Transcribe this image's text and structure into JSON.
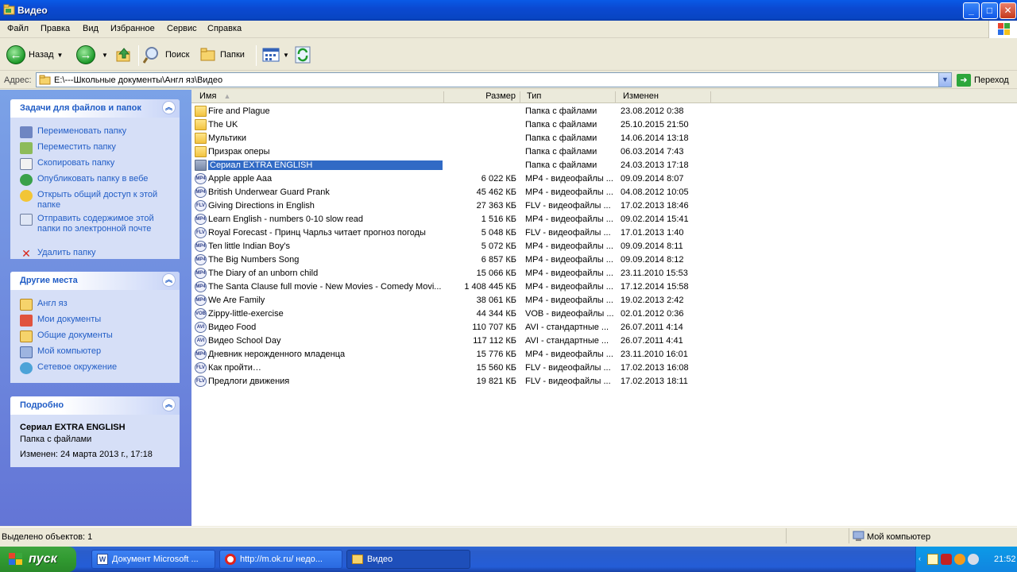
{
  "window": {
    "title": "Видео",
    "min": "_",
    "max": "□",
    "close": "✕"
  },
  "menu": [
    "Файл",
    "Правка",
    "Вид",
    "Избранное",
    "Сервис",
    "Справка"
  ],
  "toolbar": {
    "back": "Назад",
    "search": "Поиск",
    "folders": "Папки"
  },
  "address": {
    "label": "Адрес:",
    "path": "E:\\---Школьные документы\\Англ яз\\Видео",
    "go": "Переход"
  },
  "tasks_panel": {
    "title": "Задачи для файлов и папок",
    "items": [
      {
        "label": "Переименовать папку",
        "icon": "rename-icon"
      },
      {
        "label": "Переместить папку",
        "icon": "move-icon"
      },
      {
        "label": "Скопировать папку",
        "icon": "copy-icon"
      },
      {
        "label": "Опубликовать папку в вебе",
        "icon": "publish-web-icon"
      },
      {
        "label": "Открыть общий доступ к этой папке",
        "icon": "share-icon"
      },
      {
        "label": "Отправить содержимое этой папки по электронной почте",
        "icon": "email-icon"
      },
      {
        "label": "Удалить папку",
        "icon": "delete-icon"
      }
    ]
  },
  "places_panel": {
    "title": "Другие места",
    "items": [
      {
        "label": "Англ яз",
        "icon": "folder-icon"
      },
      {
        "label": "Мои документы",
        "icon": "my-documents-icon"
      },
      {
        "label": "Общие документы",
        "icon": "shared-documents-icon"
      },
      {
        "label": "Мой компьютер",
        "icon": "my-computer-icon"
      },
      {
        "label": "Сетевое окружение",
        "icon": "network-icon"
      }
    ]
  },
  "details_panel": {
    "title": "Подробно",
    "name": "Сериал EXTRA ENGLISH",
    "type": "Папка с файлами",
    "modified": "Изменен: 24 марта 2013 г., 17:18"
  },
  "columns": {
    "name": "Имя",
    "size": "Размер",
    "type": "Тип",
    "modified": "Изменен"
  },
  "files": [
    {
      "name": "Fire and Plague",
      "size": "",
      "type": "Папка с файлами",
      "modified": "23.08.2012 0:38",
      "kind": "folder"
    },
    {
      "name": "The UK",
      "size": "",
      "type": "Папка с файлами",
      "modified": "25.10.2015 21:50",
      "kind": "folder"
    },
    {
      "name": "Мультики",
      "size": "",
      "type": "Папка с файлами",
      "modified": "14.06.2014 13:18",
      "kind": "folder"
    },
    {
      "name": "Призрак оперы",
      "size": "",
      "type": "Папка с файлами",
      "modified": "06.03.2014 7:43",
      "kind": "folder"
    },
    {
      "name": "Сериал EXTRA ENGLISH",
      "size": "",
      "type": "Папка с файлами",
      "modified": "24.03.2013 17:18",
      "kind": "folder-selected"
    },
    {
      "name": "Apple apple Aaa",
      "size": "6 022 КБ",
      "type": "MP4 - видеофайлы ...",
      "modified": "09.09.2014 8:07",
      "kind": "mp4"
    },
    {
      "name": "British Underwear Guard Prank",
      "size": "45 462 КБ",
      "type": "MP4 - видеофайлы ...",
      "modified": "04.08.2012 10:05",
      "kind": "mp4"
    },
    {
      "name": "Giving Directions in English",
      "size": "27 363 КБ",
      "type": "FLV - видеофайлы ...",
      "modified": "17.02.2013 18:46",
      "kind": "flv"
    },
    {
      "name": "Learn English - numbers 0-10 slow read",
      "size": "1 516 КБ",
      "type": "MP4 - видеофайлы ...",
      "modified": "09.02.2014 15:41",
      "kind": "mp4"
    },
    {
      "name": "Royal Forecast - Принц Чарльз читает прогноз погоды",
      "size": "5 048 КБ",
      "type": "FLV - видеофайлы ...",
      "modified": "17.01.2013 1:40",
      "kind": "flv"
    },
    {
      "name": "Ten little Indian Boy's",
      "size": "5 072 КБ",
      "type": "MP4 - видеофайлы ...",
      "modified": "09.09.2014 8:11",
      "kind": "mp4"
    },
    {
      "name": "The Big Numbers Song",
      "size": "6 857 КБ",
      "type": "MP4 - видеофайлы ...",
      "modified": "09.09.2014 8:12",
      "kind": "mp4"
    },
    {
      "name": "The Diary of an unborn child",
      "size": "15 066 КБ",
      "type": "MP4 - видеофайлы ...",
      "modified": "23.11.2010 15:53",
      "kind": "mp4"
    },
    {
      "name": "The Santa Clause full movie - New Movies  -  Comedy Movi...",
      "size": "1 408 445 КБ",
      "type": "MP4 - видеофайлы ...",
      "modified": "17.12.2014 15:58",
      "kind": "mp4"
    },
    {
      "name": "We Are Family",
      "size": "38 061 КБ",
      "type": "MP4 - видеофайлы ...",
      "modified": "19.02.2013 2:42",
      "kind": "mp4"
    },
    {
      "name": "Zippy-little-exercise",
      "size": "44 344 КБ",
      "type": "VOB - видеофайлы ...",
      "modified": "02.01.2012 0:36",
      "kind": "vob"
    },
    {
      "name": "Видео Food",
      "size": "110 707 КБ",
      "type": "AVI - стандартные ...",
      "modified": "26.07.2011 4:14",
      "kind": "avi"
    },
    {
      "name": "Видео School Day",
      "size": "117 112 КБ",
      "type": "AVI - стандартные ...",
      "modified": "26.07.2011 4:41",
      "kind": "avi"
    },
    {
      "name": "Дневник нерожденного младенца",
      "size": "15 776 КБ",
      "type": "MP4 - видеофайлы ...",
      "modified": "23.11.2010 16:01",
      "kind": "mp4"
    },
    {
      "name": "Как пройти…",
      "size": "15 560 КБ",
      "type": "FLV - видеофайлы ...",
      "modified": "17.02.2013 16:08",
      "kind": "flv"
    },
    {
      "name": "Предлоги движения",
      "size": "19 821 КБ",
      "type": "FLV - видеофайлы ...",
      "modified": "17.02.2013 18:11",
      "kind": "flv"
    }
  ],
  "status": {
    "left": "Выделено объектов: 1",
    "right": "Мой компьютер"
  },
  "taskbar": {
    "start": "пуск",
    "buttons": [
      {
        "label": "Документ Microsoft ...",
        "icon": "word-icon"
      },
      {
        "label": "http://m.ok.ru/ недо...",
        "icon": "opera-icon"
      },
      {
        "label": "Видео",
        "icon": "folder-icon",
        "active": true
      }
    ],
    "clock": "21:52"
  },
  "colors": {
    "selection": "#316ac5",
    "taskPaneLink": "#215dc6",
    "titleBlue": "#0b49d1"
  }
}
